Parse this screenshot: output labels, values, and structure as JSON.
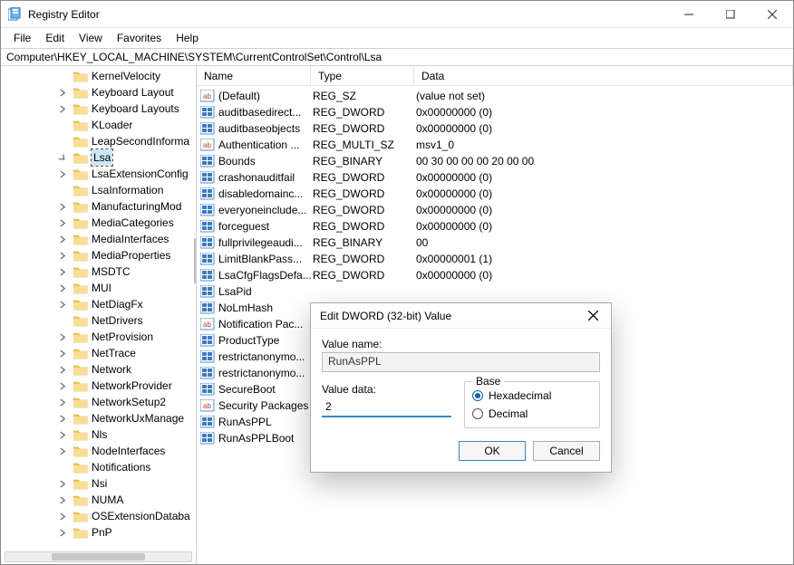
{
  "window": {
    "title": "Registry Editor"
  },
  "menubar": [
    "File",
    "Edit",
    "View",
    "Favorites",
    "Help"
  ],
  "address": "Computer\\HKEY_LOCAL_MACHINE\\SYSTEM\\CurrentControlSet\\Control\\Lsa",
  "tree": [
    {
      "label": "KernelVelocity",
      "chev": "none"
    },
    {
      "label": "Keyboard Layout",
      "chev": "closed"
    },
    {
      "label": "Keyboard Layouts",
      "chev": "closed"
    },
    {
      "label": "KLoader",
      "chev": "none"
    },
    {
      "label": "LeapSecondInforma",
      "chev": "none"
    },
    {
      "label": "Lsa",
      "chev": "open",
      "selected": true
    },
    {
      "label": "LsaExtensionConfig",
      "chev": "closed"
    },
    {
      "label": "LsaInformation",
      "chev": "none"
    },
    {
      "label": "ManufacturingMod",
      "chev": "closed"
    },
    {
      "label": "MediaCategories",
      "chev": "closed"
    },
    {
      "label": "MediaInterfaces",
      "chev": "closed"
    },
    {
      "label": "MediaProperties",
      "chev": "closed"
    },
    {
      "label": "MSDTC",
      "chev": "closed"
    },
    {
      "label": "MUI",
      "chev": "closed"
    },
    {
      "label": "NetDiagFx",
      "chev": "closed"
    },
    {
      "label": "NetDrivers",
      "chev": "none"
    },
    {
      "label": "NetProvision",
      "chev": "closed"
    },
    {
      "label": "NetTrace",
      "chev": "closed"
    },
    {
      "label": "Network",
      "chev": "closed"
    },
    {
      "label": "NetworkProvider",
      "chev": "closed"
    },
    {
      "label": "NetworkSetup2",
      "chev": "closed"
    },
    {
      "label": "NetworkUxManage",
      "chev": "closed"
    },
    {
      "label": "Nls",
      "chev": "closed"
    },
    {
      "label": "NodeInterfaces",
      "chev": "closed"
    },
    {
      "label": "Notifications",
      "chev": "none"
    },
    {
      "label": "Nsi",
      "chev": "closed"
    },
    {
      "label": "NUMA",
      "chev": "closed"
    },
    {
      "label": "OSExtensionDataba",
      "chev": "closed"
    },
    {
      "label": "PnP",
      "chev": "closed"
    }
  ],
  "columns": {
    "name": "Name",
    "type": "Type",
    "data": "Data"
  },
  "rows": [
    {
      "icon": "sz",
      "name": "(Default)",
      "type": "REG_SZ",
      "data": "(value not set)"
    },
    {
      "icon": "dw",
      "name": "auditbasedirect...",
      "type": "REG_DWORD",
      "data": "0x00000000 (0)"
    },
    {
      "icon": "dw",
      "name": "auditbaseobjects",
      "type": "REG_DWORD",
      "data": "0x00000000 (0)"
    },
    {
      "icon": "sz",
      "name": "Authentication ...",
      "type": "REG_MULTI_SZ",
      "data": "msv1_0"
    },
    {
      "icon": "dw",
      "name": "Bounds",
      "type": "REG_BINARY",
      "data": "00 30 00 00 00 20 00 00"
    },
    {
      "icon": "dw",
      "name": "crashonauditfail",
      "type": "REG_DWORD",
      "data": "0x00000000 (0)"
    },
    {
      "icon": "dw",
      "name": "disabledomainc...",
      "type": "REG_DWORD",
      "data": "0x00000000 (0)"
    },
    {
      "icon": "dw",
      "name": "everyoneinclude...",
      "type": "REG_DWORD",
      "data": "0x00000000 (0)"
    },
    {
      "icon": "dw",
      "name": "forceguest",
      "type": "REG_DWORD",
      "data": "0x00000000 (0)"
    },
    {
      "icon": "dw",
      "name": "fullprivilegeaudi...",
      "type": "REG_BINARY",
      "data": "00"
    },
    {
      "icon": "dw",
      "name": "LimitBlankPass...",
      "type": "REG_DWORD",
      "data": "0x00000001 (1)"
    },
    {
      "icon": "dw",
      "name": "LsaCfgFlagsDefa...",
      "type": "REG_DWORD",
      "data": "0x00000000 (0)"
    },
    {
      "icon": "dw",
      "name": "LsaPid",
      "type": "",
      "data": ""
    },
    {
      "icon": "dw",
      "name": "NoLmHash",
      "type": "",
      "data": ""
    },
    {
      "icon": "sz",
      "name": "Notification Pac...",
      "type": "",
      "data": ""
    },
    {
      "icon": "dw",
      "name": "ProductType",
      "type": "",
      "data": ""
    },
    {
      "icon": "dw",
      "name": "restrictanonymo...",
      "type": "",
      "data": ""
    },
    {
      "icon": "dw",
      "name": "restrictanonymo...",
      "type": "",
      "data": ""
    },
    {
      "icon": "dw",
      "name": "SecureBoot",
      "type": "",
      "data": ""
    },
    {
      "icon": "sz",
      "name": "Security Packages",
      "type": "",
      "data": ""
    },
    {
      "icon": "dw",
      "name": "RunAsPPL",
      "type": "",
      "data": ""
    },
    {
      "icon": "dw",
      "name": "RunAsPPLBoot",
      "type": "",
      "data": ""
    }
  ],
  "dialog": {
    "title": "Edit DWORD (32-bit) Value",
    "value_name_label": "Value name:",
    "value_name": "RunAsPPL",
    "value_data_label": "Value data:",
    "value_data": "2",
    "base_label": "Base",
    "hex_label": "Hexadecimal",
    "dec_label": "Decimal",
    "ok": "OK",
    "cancel": "Cancel"
  }
}
